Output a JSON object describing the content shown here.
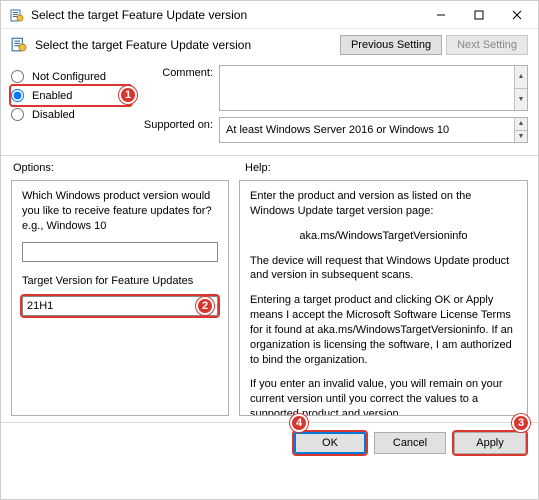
{
  "window": {
    "title": "Select the target Feature Update version",
    "header_title": "Select the target Feature Update version"
  },
  "nav": {
    "prev": "Previous Setting",
    "next": "Next Setting"
  },
  "radios": {
    "not_configured": "Not Configured",
    "enabled": "Enabled",
    "disabled": "Disabled"
  },
  "meta": {
    "comment_label": "Comment:",
    "comment_value": "",
    "supported_label": "Supported on:",
    "supported_value": "At least Windows Server 2016 or Windows 10"
  },
  "labels": {
    "options": "Options:",
    "help": "Help:"
  },
  "options": {
    "question": "Which Windows product version would you like to receive feature updates for? e.g., Windows 10",
    "product_value": "",
    "target_label": "Target Version for Feature Updates",
    "target_value": "21H1"
  },
  "help": {
    "p1": "Enter the product and version as listed on the Windows Update target version page:",
    "p2": "aka.ms/WindowsTargetVersioninfo",
    "p3": "The device will request that Windows Update product and version in subsequent scans.",
    "p4": "Entering a target product and clicking OK or Apply means I accept the Microsoft Software License Terms for it found at aka.ms/WindowsTargetVersioninfo. If an organization is licensing the software, I am authorized to bind the organization.",
    "p5": "If you enter an invalid value, you will remain on your current version until you correct the values to a supported product and version."
  },
  "footer": {
    "ok": "OK",
    "cancel": "Cancel",
    "apply": "Apply"
  },
  "callouts": {
    "c1": "1",
    "c2": "2",
    "c3": "3",
    "c4": "4"
  }
}
